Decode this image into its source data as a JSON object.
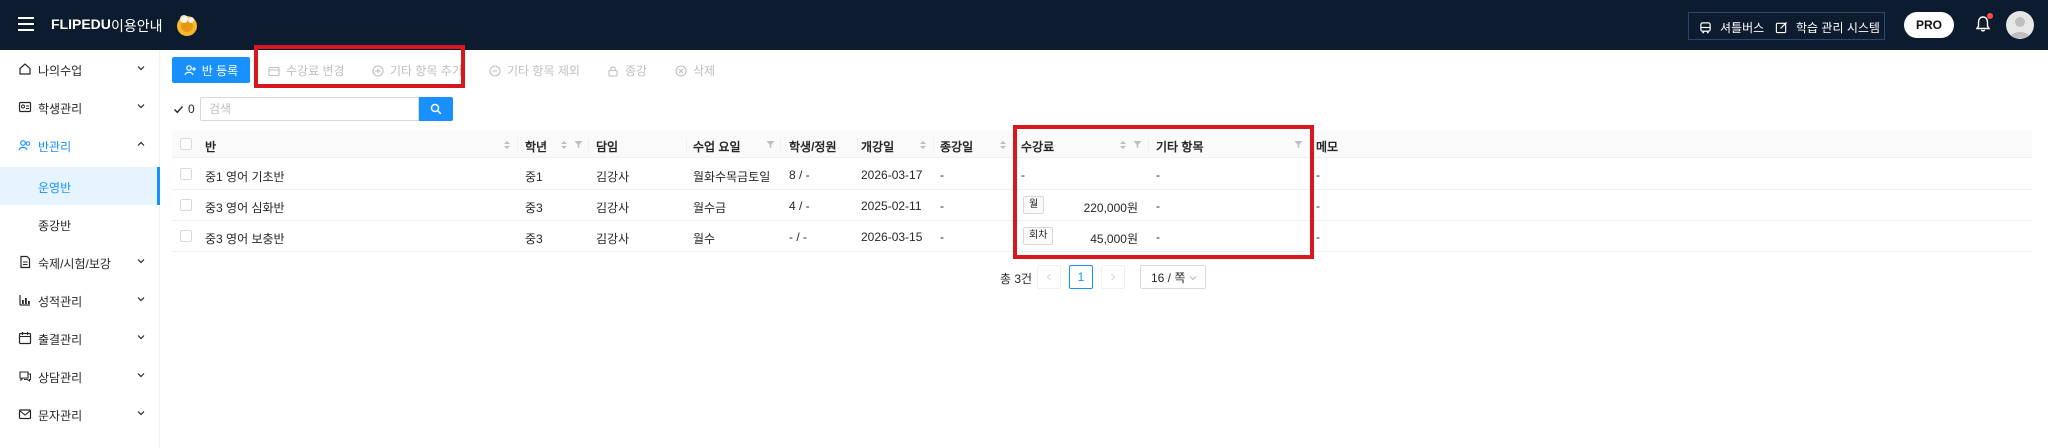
{
  "header": {
    "brand": "FLIPEDU",
    "guide_link": "이용안내",
    "shuttle_label": "셔틀버스",
    "lms_label": "학습 관리 시스템",
    "pro_label": "PRO"
  },
  "sidebar": {
    "items": [
      {
        "label": "나의수업"
      },
      {
        "label": "학생관리"
      },
      {
        "label": "반관리"
      },
      {
        "label": "숙제/시험/보강"
      },
      {
        "label": "성적관리"
      },
      {
        "label": "출결관리"
      },
      {
        "label": "상담관리"
      },
      {
        "label": "문자관리"
      }
    ],
    "subitems": [
      {
        "label": "운영반"
      },
      {
        "label": "종강반"
      }
    ]
  },
  "toolbar": {
    "register": "반 등록",
    "fee_change": "수강료 변경",
    "add_other": "기타 항목 추가",
    "remove_other": "기타 항목 제외",
    "close": "종강",
    "delete": "삭제"
  },
  "search": {
    "selected_count": "0",
    "placeholder": "검색"
  },
  "table": {
    "columns": {
      "class": "반",
      "grade": "학년",
      "teacher": "담임",
      "days": "수업 요일",
      "students": "학생/정원",
      "start": "개강일",
      "end": "종강일",
      "fee": "수강료",
      "other": "기타 항목",
      "memo": "메모"
    },
    "rows": [
      {
        "class": "중1 영어 기초반",
        "grade": "중1",
        "teacher": "김강사",
        "days": "월화수목금토일",
        "students": "8 / -",
        "start": "2026-03-17",
        "end": "-",
        "fee_tag": "",
        "fee": "-",
        "other": "-",
        "memo": "-"
      },
      {
        "class": "중3 영어 심화반",
        "grade": "중3",
        "teacher": "김강사",
        "days": "월수금",
        "students": "4 / -",
        "start": "2025-02-11",
        "end": "-",
        "fee_tag": "월",
        "fee": "220,000원",
        "other": "-",
        "memo": "-"
      },
      {
        "class": "중3 영어 보충반",
        "grade": "중3",
        "teacher": "김강사",
        "days": "월수",
        "students": "- / -",
        "start": "2026-03-15",
        "end": "-",
        "fee_tag": "회차",
        "fee": "45,000원",
        "other": "-",
        "memo": "-"
      }
    ]
  },
  "pagination": {
    "total": "총 3건",
    "current_page": "1",
    "page_size": "16 / 쪽"
  },
  "colors": {
    "topbar": "#0d1b2e",
    "primary": "#1890ff",
    "highlight": "#d7191f"
  }
}
